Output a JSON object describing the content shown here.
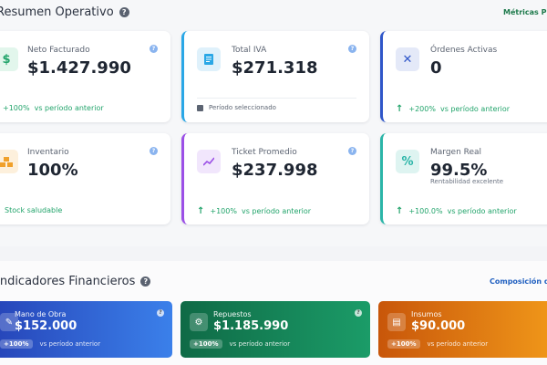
{
  "resumen": {
    "title": "Resumen Operativo",
    "link": "Métricas Principales",
    "cards": [
      {
        "label": "Neto Facturado",
        "value": "$1.427.990",
        "trend": "+100%",
        "trend_text": "vs período anterior"
      },
      {
        "label": "Total IVA",
        "value": "$271.318",
        "foot_text": "Período seleccionado"
      },
      {
        "label": "Órdenes Activas",
        "value": "0",
        "trend": "+200%",
        "trend_text": "vs período anterior"
      },
      {
        "label": "Inventario",
        "value": "100%",
        "foot_text": "Stock saludable"
      },
      {
        "label": "Ticket Promedio",
        "value": "$237.998",
        "trend": "+100%",
        "trend_text": "vs período anterior"
      },
      {
        "label": "Margen Real",
        "value": "99.5%",
        "sub": "Rentabilidad excelente",
        "trend": "+100.0%",
        "trend_text": "vs período anterior"
      }
    ]
  },
  "indicadores": {
    "title": "Indicadores Financieros",
    "link": "Composición de Ingresos",
    "cards": [
      {
        "label": "Mano de Obra",
        "value": "$152.000",
        "trend": "+100%",
        "trend_text": "vs período anterior"
      },
      {
        "label": "Repuestos",
        "value": "$1.185.990",
        "trend": "+100%",
        "trend_text": "vs período anterior"
      },
      {
        "label": "Insumos",
        "value": "$90.000",
        "trend": "+100%",
        "trend_text": "vs período anterior"
      }
    ]
  },
  "icons": {
    "neto": "dollar-icon",
    "iva": "document-icon",
    "ordenes": "tools-icon",
    "inventario": "boxes-icon",
    "ticket": "chart-line-icon",
    "margen": "percent-icon",
    "mano": "wrench-icon",
    "repuestos": "gear-icon",
    "insumos": "box-icon"
  },
  "colors": {
    "green": "#22a46b",
    "blue": "#2aa7e6",
    "indigo": "#2f56c9",
    "purple": "#9b4fe6",
    "teal": "#2bb5a8",
    "link_green": "#1e7a4c",
    "link_blue": "#1f5fc0"
  }
}
